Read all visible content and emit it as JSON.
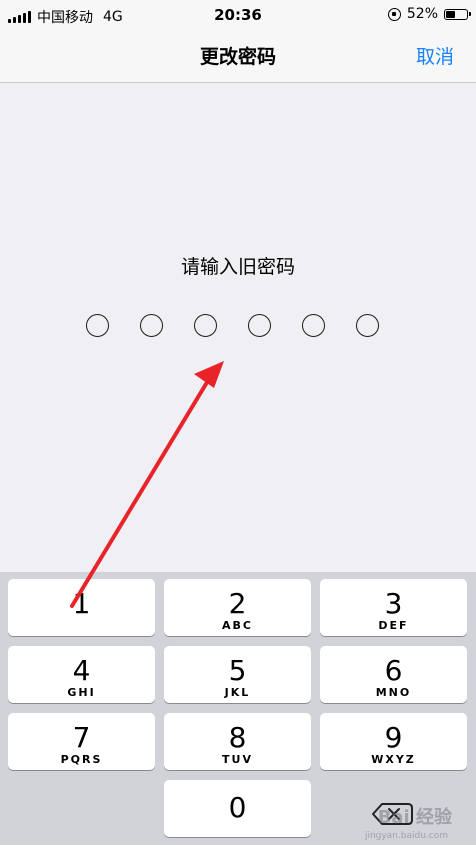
{
  "status_bar": {
    "carrier": "中国移动",
    "network": "4G",
    "time": "20:36",
    "battery_text": "52%",
    "battery_level": 0.52
  },
  "nav": {
    "title": "更改密码",
    "cancel_label": "取消"
  },
  "prompt": "请输入旧密码",
  "passcode_length": 6,
  "keypad": {
    "keys": [
      {
        "digit": "1",
        "letters": ""
      },
      {
        "digit": "2",
        "letters": "ABC"
      },
      {
        "digit": "3",
        "letters": "DEF"
      },
      {
        "digit": "4",
        "letters": "GHI"
      },
      {
        "digit": "5",
        "letters": "JKL"
      },
      {
        "digit": "6",
        "letters": "MNO"
      },
      {
        "digit": "7",
        "letters": "PQRS"
      },
      {
        "digit": "8",
        "letters": "TUV"
      },
      {
        "digit": "9",
        "letters": "WXYZ"
      },
      {
        "digit": "0",
        "letters": ""
      }
    ]
  },
  "watermark": {
    "text": "Bai 经验",
    "sub": "jingyan.baidu.com"
  },
  "colors": {
    "accent": "#1a82fb",
    "annotation_arrow": "#e8242a"
  }
}
